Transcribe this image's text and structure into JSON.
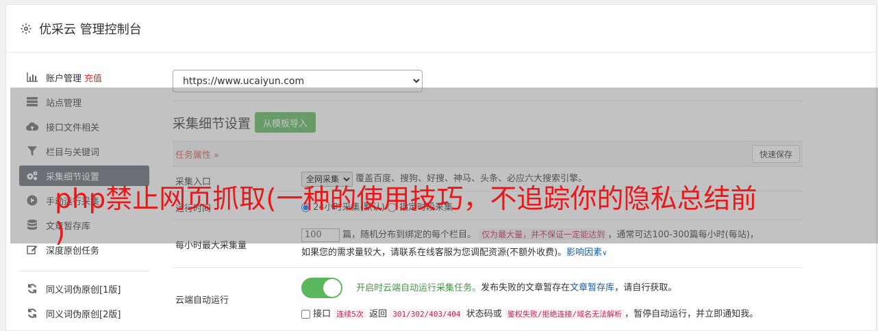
{
  "header": {
    "title": "优采云 管理控制台",
    "icon": "gear-icon"
  },
  "sidebar": {
    "items": [
      {
        "label": "账户管理",
        "badge": "充值",
        "icon": "bar-chart-icon"
      },
      {
        "label": "站点管理",
        "icon": "server-icon"
      },
      {
        "label": "接口文件相关",
        "icon": "cloud-upload-icon"
      },
      {
        "label": "栏目与关键词",
        "icon": "filter-icon"
      },
      {
        "label": "采集细节设置",
        "icon": "gears-icon",
        "active": true
      },
      {
        "label": "手动运行采集",
        "icon": "play-circle-icon"
      },
      {
        "label": "文章暂存库",
        "icon": "database-icon"
      },
      {
        "label": "深度原创任务",
        "icon": "edit-icon"
      }
    ],
    "items2": [
      {
        "label": "同义词伪原创[1版]",
        "icon": "refresh-icon"
      },
      {
        "label": "同义词伪原创[2版]",
        "icon": "refresh-icon"
      }
    ]
  },
  "main": {
    "site_select": "https://www.ucaiyun.com",
    "section_title": "采集细节设置",
    "import_button": "从模板导入",
    "attr_title": "任务属性 »",
    "quick_save": "快速保存",
    "rows": {
      "entry": {
        "label": "采集入口",
        "select": "全网采集",
        "desc": "覆盖百度、搜狗、好搜、神马、头条、必应六大搜索引擎。"
      },
      "time": {
        "label": "运行时间",
        "radio": "24小时采集(默认)",
        "desc": "指定时段采集"
      },
      "hourly": {
        "label": "每小时最大采集量",
        "input": "100",
        "text1": "篇，随机分布到绑定的每个栏目。",
        "warn": "仅为最大量，并不保证一定能达到",
        "text2": "，通常可达100-300篇每小时(每站)，",
        "text3": "如果您的需求量较大，请联系在线客服为您调配资源(不额外收费)。",
        "link": "影响因素"
      },
      "cloud": {
        "label": "云端自动运行",
        "green": "开启时云端自动运行采集任务。",
        "text1": "发布失败的文章暂存在",
        "link": "文章暂存库",
        "text2": "，请自行获取。",
        "chk_label": "接口",
        "code1": "连续5次",
        "t_return": "返回",
        "code2": "301/302/403/404",
        "t_status": "状态码或",
        "code3": "鉴权失败/拒绝连接/域名无法解析",
        "t_end": "，暂停自动运行，并立即通知我。"
      }
    }
  },
  "watermark": {
    "line1": "php禁止网页抓取(一种的使用技巧，不追踪你的隐私总结前",
    "line2": ")"
  },
  "colors": {
    "accent_green": "#5cb85c",
    "active_nav": "#5e6874",
    "warn_red": "#d9534f",
    "watermark_red": "#e8181b"
  }
}
